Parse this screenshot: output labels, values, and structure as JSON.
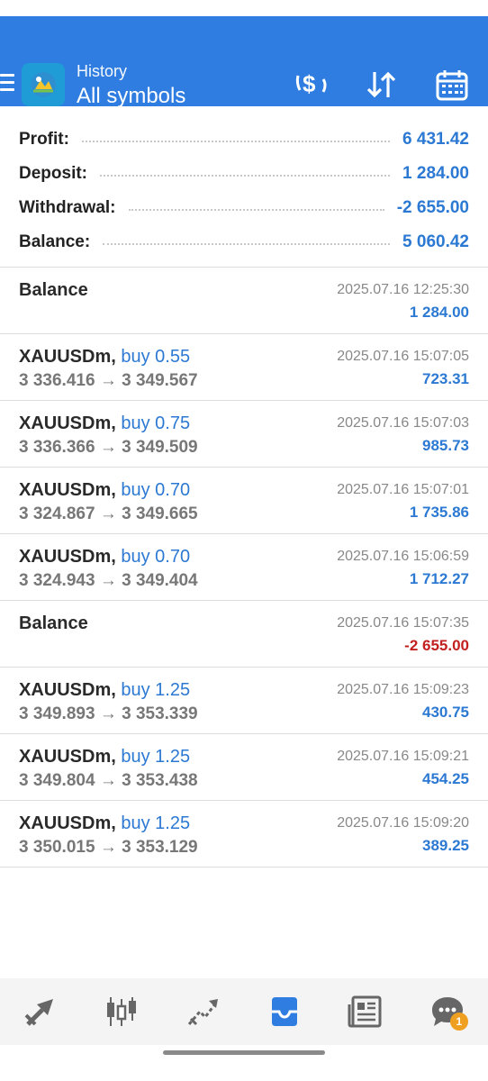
{
  "header": {
    "subtitle": "History",
    "title": "All symbols"
  },
  "summary": [
    {
      "label": "Profit:",
      "value": "6 431.42"
    },
    {
      "label": "Deposit:",
      "value": "1 284.00"
    },
    {
      "label": "Withdrawal:",
      "value": "-2 655.00"
    },
    {
      "label": "Balance:",
      "value": "5 060.42"
    }
  ],
  "rows": [
    {
      "symbol": "Balance",
      "time": "2025.07.16 12:25:30",
      "pnl": "1 284.00"
    },
    {
      "symbol": "XAUUSDm,",
      "side": "buy 0.55",
      "open": "3 336.416",
      "arrow": "→",
      "close": "3 349.567",
      "time": "2025.07.16 15:07:05",
      "pnl": "723.31"
    },
    {
      "symbol": "XAUUSDm,",
      "side": "buy 0.75",
      "open": "3 336.366",
      "arrow": "→",
      "close": "3 349.509",
      "time": "2025.07.16 15:07:03",
      "pnl": "985.73"
    },
    {
      "symbol": "XAUUSDm,",
      "side": "buy 0.70",
      "open": "3 324.867",
      "arrow": "→",
      "close": "3 349.665",
      "time": "2025.07.16 15:07:01",
      "pnl": "1 735.86"
    },
    {
      "symbol": "XAUUSDm,",
      "side": "buy 0.70",
      "open": "3 324.943",
      "arrow": "→",
      "close": "3 349.404",
      "time": "2025.07.16 15:06:59",
      "pnl": "1 712.27"
    },
    {
      "symbol": "Balance",
      "time": "2025.07.16 15:07:35",
      "pnl": "-2 655.00"
    },
    {
      "symbol": "XAUUSDm,",
      "side": "buy 1.25",
      "open": "3 349.893",
      "arrow": "→",
      "close": "3 353.339",
      "time": "2025.07.16 15:09:23",
      "pnl": "430.75"
    },
    {
      "symbol": "XAUUSDm,",
      "side": "buy 1.25",
      "open": "3 349.804",
      "arrow": "→",
      "close": "3 353.438",
      "time": "2025.07.16 15:09:21",
      "pnl": "454.25"
    },
    {
      "symbol": "XAUUSDm,",
      "side": "buy 1.25",
      "open": "3 350.015",
      "arrow": "→",
      "close": "3 353.129",
      "time": "2025.07.16 15:09:20",
      "pnl": "389.25"
    }
  ],
  "nav": {
    "chat_badge": "1",
    "icons": [
      "quotes-icon",
      "chart-icon",
      "trade-icon",
      "history-icon",
      "news-icon",
      "chat-icon"
    ]
  },
  "colors": {
    "header_bg": "#2f7de1",
    "positive": "#2c79d3",
    "negative": "#c21f1f"
  }
}
